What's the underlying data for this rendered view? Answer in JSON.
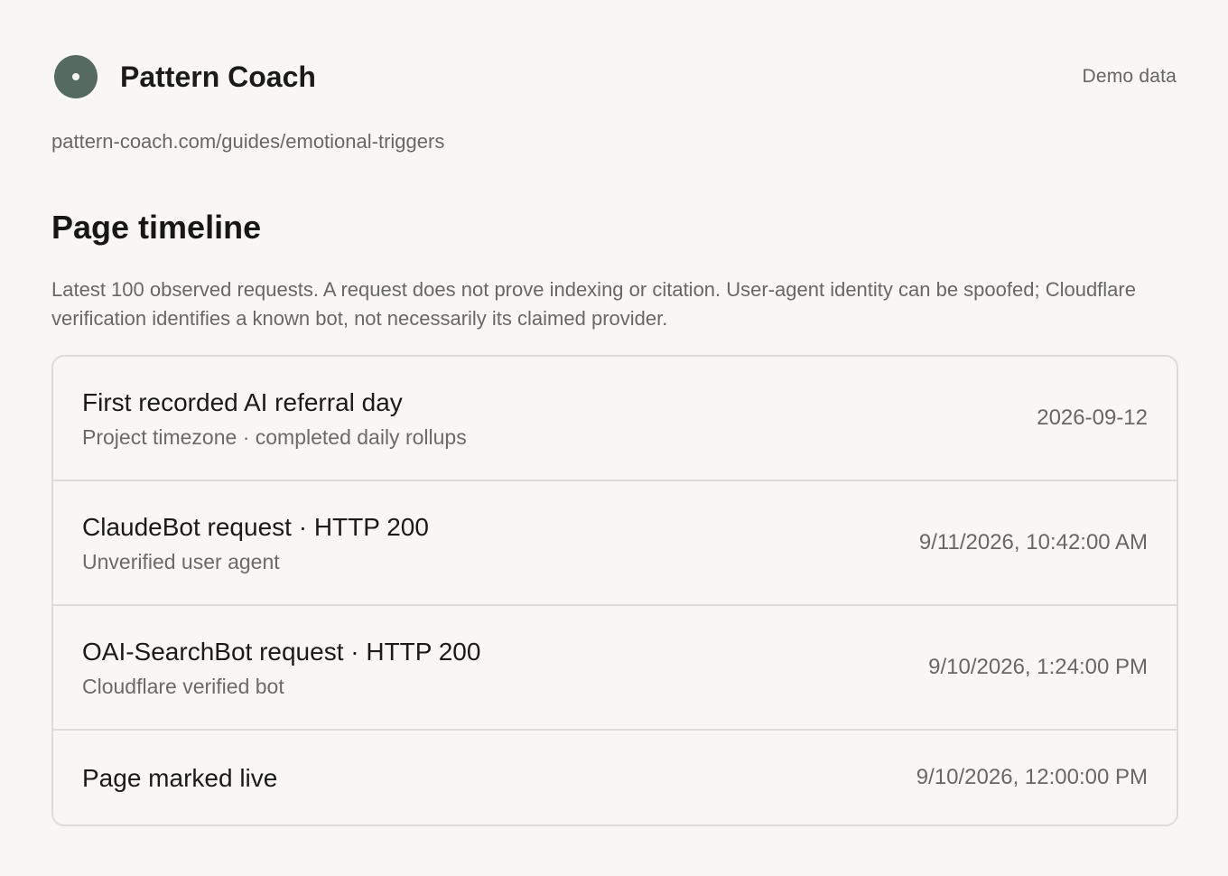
{
  "brand": {
    "name": "Pattern Coach",
    "mode_label": "Demo data",
    "logo_icon": "radio-dot-icon",
    "accent_color": "#556b5f"
  },
  "page": {
    "url": "pattern-coach.com/guides/emotional-triggers"
  },
  "timeline": {
    "title": "Page timeline",
    "description": "Latest 100 observed requests. A request does not prove indexing or citation. User-agent identity can be spoofed; Cloudflare verification identifies a known bot, not necessarily its claimed provider.",
    "items": [
      {
        "title": "First recorded AI referral day",
        "subtitle": "Project timezone · completed daily rollups",
        "time": "2026-09-12"
      },
      {
        "title": "ClaudeBot request · HTTP 200",
        "subtitle": "Unverified user agent",
        "time": "9/11/2026, 10:42:00 AM"
      },
      {
        "title": "OAI-SearchBot request · HTTP 200",
        "subtitle": "Cloudflare verified bot",
        "time": "9/10/2026, 1:24:00 PM"
      },
      {
        "title": "Page marked live",
        "subtitle": "",
        "time": "9/10/2026, 12:00:00 PM"
      }
    ]
  }
}
